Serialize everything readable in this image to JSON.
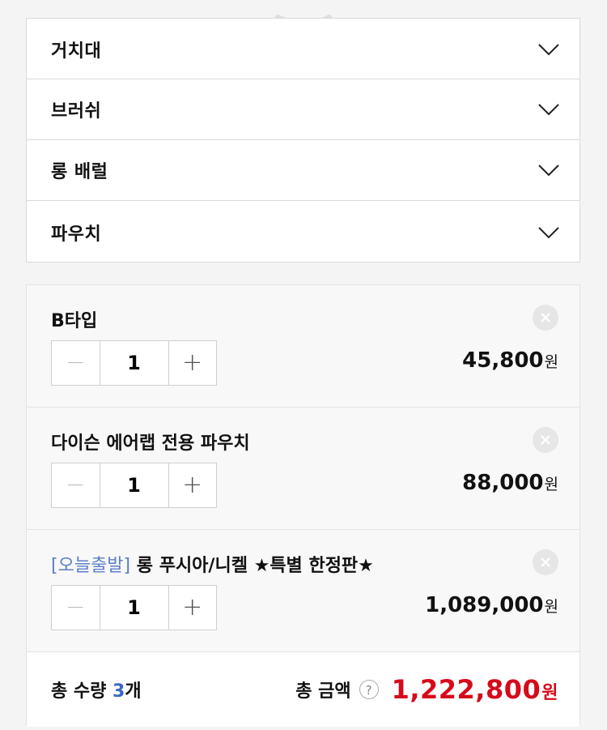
{
  "accordion": {
    "items": [
      {
        "label": "거치대",
        "icon": "chevron-down-icon"
      },
      {
        "label": "브러쉬",
        "icon": "chevron-down-icon"
      },
      {
        "label": "롱 배럴",
        "icon": "chevron-down-icon"
      },
      {
        "label": "파우치",
        "icon": "chevron-down-icon"
      }
    ]
  },
  "cart": {
    "items": [
      {
        "tag": "",
        "name": "B타입",
        "quantity": "1",
        "price": "45,800",
        "currency": "원"
      },
      {
        "tag": "",
        "name": "다이슨 에어랩 전용 파우치",
        "quantity": "1",
        "price": "88,000",
        "currency": "원"
      },
      {
        "tag": "[오늘출발]",
        "name": " 롱 푸시아/니켈 ★특별 한정판★",
        "quantity": "1",
        "price": "1,089,000",
        "currency": "원"
      }
    ],
    "minus": "−",
    "plus": "+"
  },
  "summary": {
    "qty_label": "총 수량 ",
    "qty_count": "3",
    "qty_unit": "개",
    "amount_label": "총 금액",
    "help": "?",
    "amount": "1,222,800",
    "currency": "원"
  },
  "colors": {
    "accent_blue": "#3a67c8",
    "tag_blue": "#5b7fc9",
    "total_red": "#d60a1a"
  }
}
